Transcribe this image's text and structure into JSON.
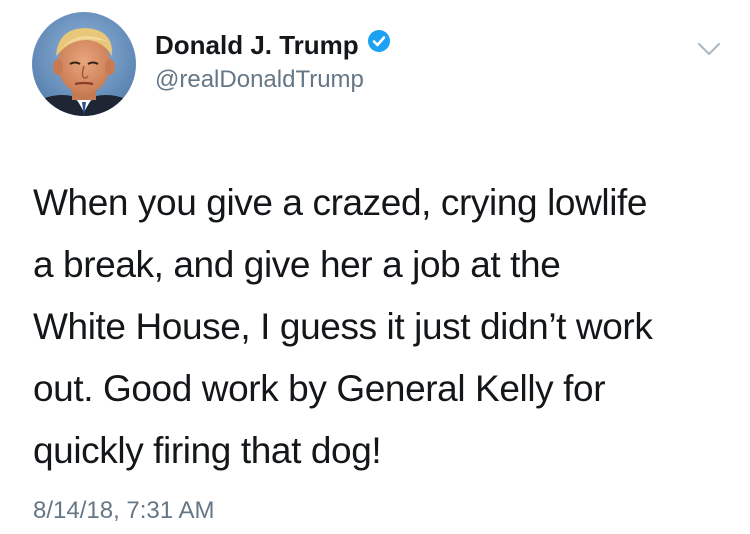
{
  "author": {
    "display_name": "Donald J. Trump",
    "handle": "@realDonaldTrump",
    "verified": true,
    "verified_color": "#1da1f2"
  },
  "menu": {
    "icon": "chevron-down-icon"
  },
  "tweet": {
    "lines": [
      "When you give a crazed, crying lowlife",
      "a break, and give her a job at the",
      "White House, I guess it just didn’t work",
      "out. Good work by General Kelly for",
      "quickly firing that dog!"
    ],
    "timestamp": "8/14/18, 7:31 AM"
  },
  "colors": {
    "text": "#14171a",
    "secondary_text": "#657786",
    "background": "#ffffff"
  }
}
